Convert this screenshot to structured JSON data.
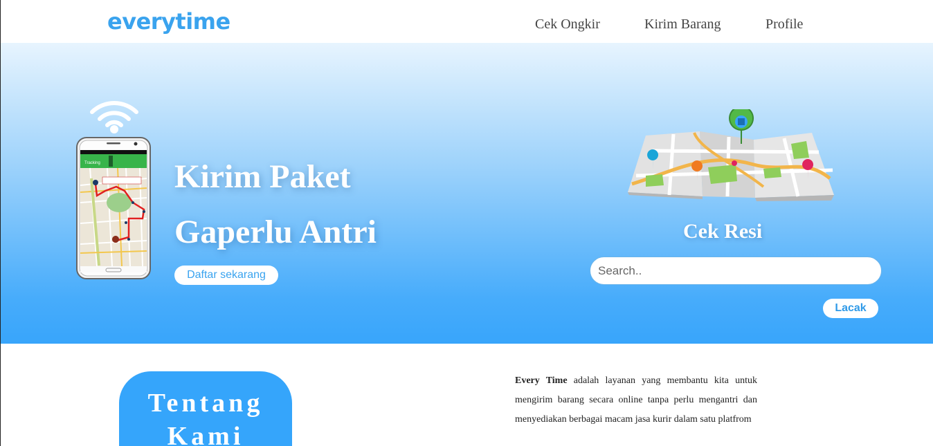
{
  "brand": "everytime",
  "nav": {
    "items": [
      "Cek Ongkir",
      "Kirim Barang",
      "Profile"
    ]
  },
  "hero": {
    "title_line1": "Kirim Paket",
    "title_line2": "Gaperlu Antri",
    "cta_label": "Daftar sekarang",
    "phone_app_header": "Tracking"
  },
  "tracking": {
    "title": "Cek Resi",
    "search_placeholder": "Search..",
    "button_label": "Lacak"
  },
  "about": {
    "title": "Tentang Kami",
    "brand_name": "Every Time",
    "description": " adalah layanan yang membantu kita untuk mengirim barang secara online tanpa perlu mengantri dan menyediakan berbagai macam jasa kurir dalam satu platfrom"
  },
  "colors": {
    "brand": "#3aa3ee",
    "hero_top": "#e7f4fe",
    "hero_bottom": "#38a5fb",
    "about_box": "#35a5fb"
  },
  "icons": [
    "wifi-icon",
    "phone-map-illustration",
    "map-pin-illustration"
  ]
}
